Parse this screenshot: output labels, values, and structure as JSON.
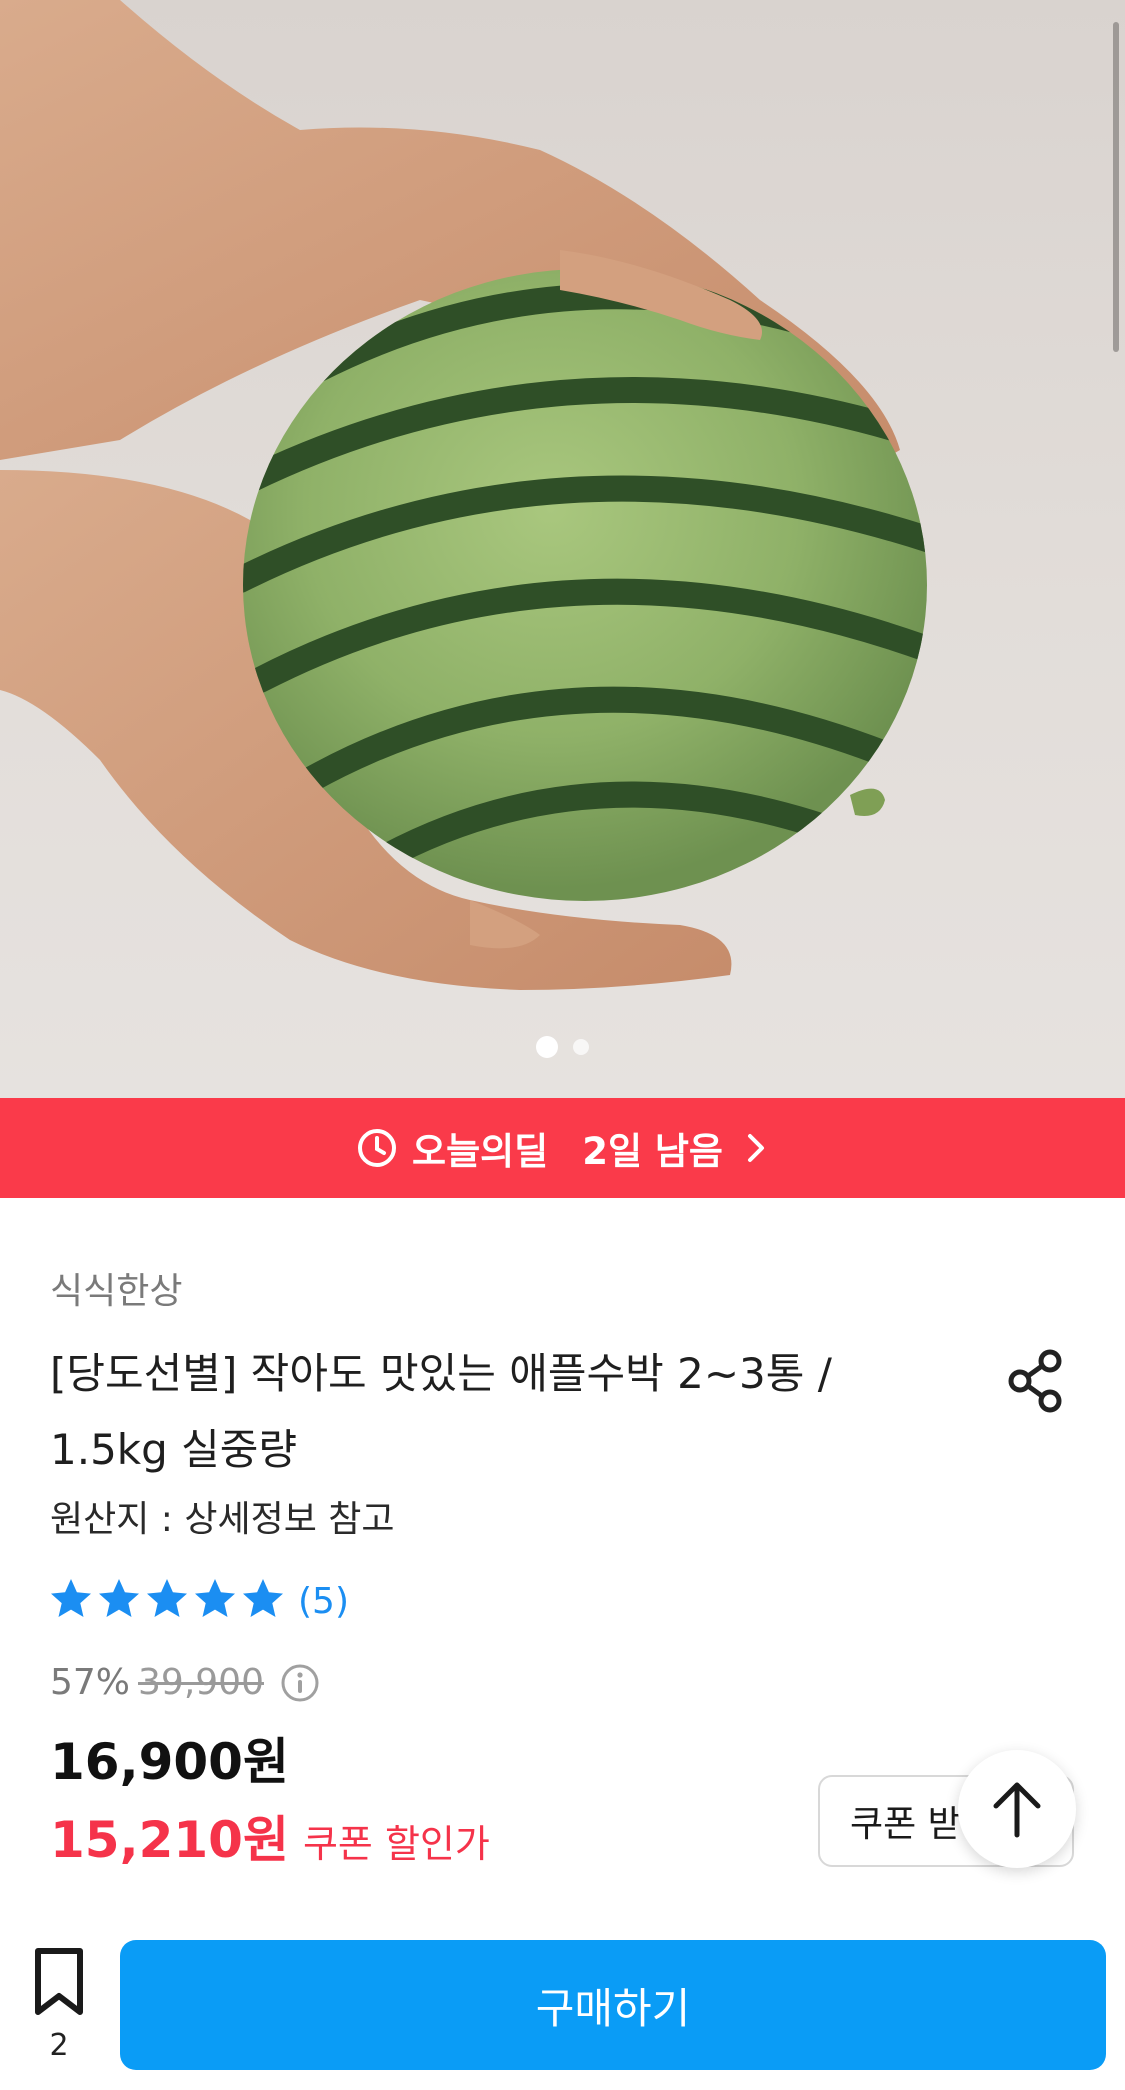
{
  "hero": {
    "image_alt": "hands holding a small striped watermelon",
    "carousel_dots": 2,
    "active_dot": 0
  },
  "deal_banner": {
    "label": "오늘의딜",
    "remaining": "2일 남음",
    "icon": "clock-icon",
    "color": "#fa3a4a"
  },
  "product": {
    "brand": "식식한상",
    "title": "[당도선별] 작아도 맛있는 애플수박 2~3통 / 1.5kg 실중량",
    "origin": "원산지 : 상세정보 참고",
    "rating": 5,
    "review_count": "(5)",
    "discount": "57%",
    "original_price": "39,900",
    "price": "16,900원",
    "coupon_price": "15,210원",
    "coupon_price_label": "쿠폰 할인가"
  },
  "actions": {
    "coupon_button": "쿠폰 받기",
    "scroll_top_icon": "arrow-up-icon",
    "share_icon": "share-icon",
    "bookmark_count": "2",
    "buy_button": "구매하기"
  },
  "colors": {
    "accent_blue": "#0a9cf6",
    "sale_red": "#f5334a",
    "star_blue": "#1b8ef2"
  }
}
